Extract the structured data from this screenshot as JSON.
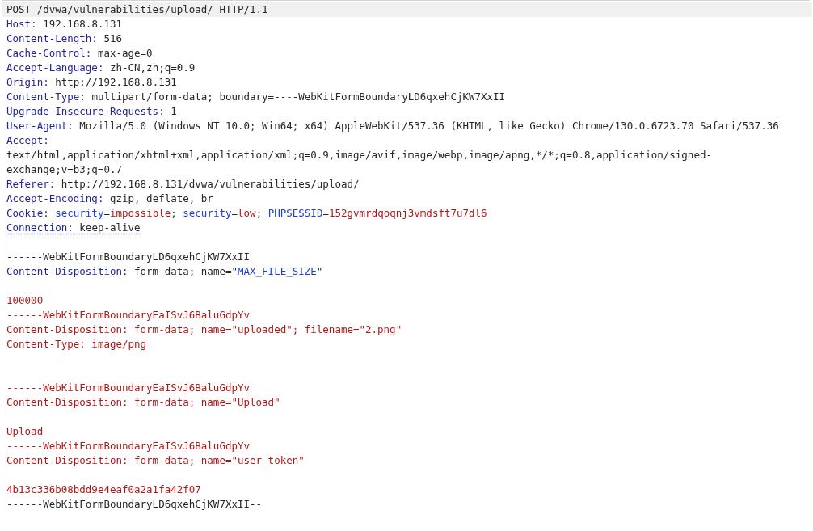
{
  "editor": {
    "lines": [
      {
        "current": true,
        "underlined": false,
        "segments": [
          {
            "kind": "plain",
            "text": "POST /dvwa/vulnerabilities/upload/ HTTP/1.1"
          }
        ]
      },
      {
        "current": false,
        "underlined": false,
        "segments": [
          {
            "kind": "name",
            "text": "Host:"
          },
          {
            "kind": "plain",
            "text": " 192.168.8.131"
          }
        ]
      },
      {
        "current": false,
        "underlined": false,
        "segments": [
          {
            "kind": "name",
            "text": "Content-Length:"
          },
          {
            "kind": "plain",
            "text": " 516"
          }
        ]
      },
      {
        "current": false,
        "underlined": false,
        "segments": [
          {
            "kind": "name",
            "text": "Cache-Control:"
          },
          {
            "kind": "plain",
            "text": " max-age=0"
          }
        ]
      },
      {
        "current": false,
        "underlined": false,
        "segments": [
          {
            "kind": "name",
            "text": "Accept-Language:"
          },
          {
            "kind": "plain",
            "text": " zh-CN,zh;q=0.9"
          }
        ]
      },
      {
        "current": false,
        "underlined": false,
        "segments": [
          {
            "kind": "name",
            "text": "Origin:"
          },
          {
            "kind": "plain",
            "text": " http://192.168.8.131"
          }
        ]
      },
      {
        "current": false,
        "underlined": false,
        "segments": [
          {
            "kind": "name",
            "text": "Content-Type:"
          },
          {
            "kind": "plain",
            "text": " multipart/form-data; boundary=----WebKitFormBoundaryLD6qxehCjKW7XxII"
          }
        ]
      },
      {
        "current": false,
        "underlined": false,
        "segments": [
          {
            "kind": "name",
            "text": "Upgrade-Insecure-Requests:"
          },
          {
            "kind": "plain",
            "text": " 1"
          }
        ]
      },
      {
        "current": false,
        "underlined": false,
        "segments": [
          {
            "kind": "name",
            "text": "User-Agent:"
          },
          {
            "kind": "plain",
            "text": " Mozilla/5.0 (Windows NT 10.0; Win64; x64) AppleWebKit/537.36 (KHTML, like Gecko) Chrome/130.0.6723.70 Safari/537.36"
          }
        ]
      },
      {
        "current": false,
        "underlined": false,
        "segments": [
          {
            "kind": "name",
            "text": "Accept: "
          },
          {
            "kind": "plain",
            "text": "text/html,application/xhtml+xml,application/xml;q=0.9,image/avif,image/webp,image/apng,*/*;q=0.8,application/signed-exchange;v=b3;q=0.7"
          }
        ]
      },
      {
        "current": false,
        "underlined": false,
        "segments": [
          {
            "kind": "name",
            "text": "Referer:"
          },
          {
            "kind": "plain",
            "text": " http://192.168.8.131/dvwa/vulnerabilities/upload/"
          }
        ]
      },
      {
        "current": false,
        "underlined": false,
        "segments": [
          {
            "kind": "name",
            "text": "Accept-Encoding:"
          },
          {
            "kind": "plain",
            "text": " gzip, deflate, br"
          }
        ]
      },
      {
        "current": false,
        "underlined": false,
        "segments": [
          {
            "kind": "name",
            "text": "Cookie:"
          },
          {
            "kind": "param",
            "text": " security"
          },
          {
            "kind": "plain",
            "text": "="
          },
          {
            "kind": "value",
            "text": "impossible"
          },
          {
            "kind": "plain",
            "text": "; "
          },
          {
            "kind": "param",
            "text": "security"
          },
          {
            "kind": "plain",
            "text": "="
          },
          {
            "kind": "value",
            "text": "low"
          },
          {
            "kind": "plain",
            "text": "; "
          },
          {
            "kind": "param",
            "text": "PHPSESSID"
          },
          {
            "kind": "plain",
            "text": "="
          },
          {
            "kind": "value",
            "text": "152gvmrdqoqnj3vmdsft7u7dl6"
          }
        ]
      },
      {
        "current": false,
        "underlined": true,
        "segments": [
          {
            "kind": "name",
            "text": "Connection:"
          },
          {
            "kind": "plain",
            "text": " keep-alive"
          }
        ]
      },
      {
        "current": false
      },
      {
        "current": false,
        "underlined": false,
        "segments": [
          {
            "kind": "plain",
            "text": "------WebKitFormBoundaryLD6qxehCjKW7XxII"
          }
        ]
      },
      {
        "current": false,
        "underlined": false,
        "segments": [
          {
            "kind": "name",
            "text": "Content-Disposition:"
          },
          {
            "kind": "plain",
            "text": " form-data; name=\""
          },
          {
            "kind": "param",
            "text": "MAX_FILE_SIZE"
          },
          {
            "kind": "plain",
            "text": "\""
          }
        ]
      },
      {
        "current": false
      },
      {
        "current": false,
        "underlined": false,
        "segments": [
          {
            "kind": "value",
            "text": "100000"
          }
        ]
      },
      {
        "current": false,
        "underlined": false,
        "segments": [
          {
            "kind": "value",
            "text": "------WebKitFormBoundaryEaISvJ6BaluGdpYv"
          }
        ]
      },
      {
        "current": false,
        "underlined": false,
        "segments": [
          {
            "kind": "value",
            "text": "Content-Disposition: form-data; name=\"uploaded\"; filename=\"2.png\""
          }
        ]
      },
      {
        "current": false,
        "underlined": false,
        "segments": [
          {
            "kind": "value",
            "text": "Content-Type: image/png"
          }
        ]
      },
      {
        "current": false
      },
      {
        "current": false
      },
      {
        "current": false,
        "underlined": false,
        "segments": [
          {
            "kind": "value",
            "text": "------WebKitFormBoundaryEaISvJ6BaluGdpYv"
          }
        ]
      },
      {
        "current": false,
        "underlined": false,
        "segments": [
          {
            "kind": "value",
            "text": "Content-Disposition: form-data; name=\"Upload\""
          }
        ]
      },
      {
        "current": false
      },
      {
        "current": false,
        "underlined": false,
        "segments": [
          {
            "kind": "value",
            "text": "Upload"
          }
        ]
      },
      {
        "current": false,
        "underlined": false,
        "segments": [
          {
            "kind": "value",
            "text": "------WebKitFormBoundaryEaISvJ6BaluGdpYv"
          }
        ]
      },
      {
        "current": false,
        "underlined": false,
        "segments": [
          {
            "kind": "value",
            "text": "Content-Disposition: form-data; name=\"user_token\""
          }
        ]
      },
      {
        "current": false
      },
      {
        "current": false,
        "underlined": false,
        "segments": [
          {
            "kind": "value",
            "text": "4b13c336b08bdd9e4eaf0a2a1fa42f07"
          }
        ]
      },
      {
        "current": false,
        "underlined": false,
        "segments": [
          {
            "kind": "plain",
            "text": "------WebKitFormBoundaryLD6qxehCjKW7XxII--"
          }
        ]
      }
    ]
  }
}
